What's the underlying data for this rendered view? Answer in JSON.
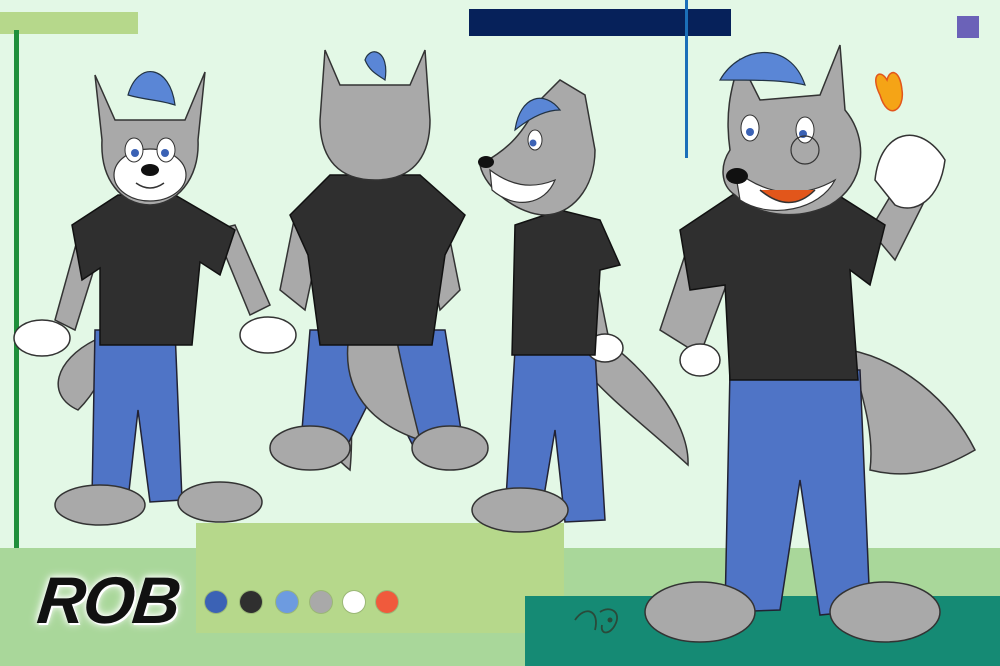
{
  "character": {
    "name": "ROB",
    "signature": "JD Pat"
  },
  "palette": {
    "swatches": [
      {
        "label": "hair-blue",
        "color": "#3b62b5"
      },
      {
        "label": "shirt-black",
        "color": "#2f2f2f"
      },
      {
        "label": "jeans-blue",
        "color": "#6d9be0"
      },
      {
        "label": "fur-gray",
        "color": "#a9a9a9"
      },
      {
        "label": "fur-white",
        "color": "#ffffff"
      },
      {
        "label": "accent-orange",
        "color": "#f05a3c"
      }
    ]
  },
  "colors": {
    "background": "#e3f8e6",
    "band_light_green": "#a9d79a",
    "band_lime": "#b6d88b",
    "band_teal": "#158a74",
    "accent_navy": "#06215a",
    "accent_blue_line": "#1b6fb9",
    "accent_purple": "#6b62b8",
    "accent_green_line": "#1f8f3b",
    "fur_gray": "#a9a9a9",
    "fur_white": "#ffffff",
    "shirt": "#2f2f2f",
    "jeans": "#4f74c6",
    "hair": "#5a86d6",
    "flame": "#f5a416"
  },
  "views": [
    {
      "label": "front-view",
      "icon": "wolf-front-figure"
    },
    {
      "label": "back-view",
      "icon": "wolf-back-figure"
    },
    {
      "label": "side-view",
      "icon": "wolf-side-figure"
    },
    {
      "label": "pose-view",
      "icon": "wolf-pose-figure"
    }
  ]
}
